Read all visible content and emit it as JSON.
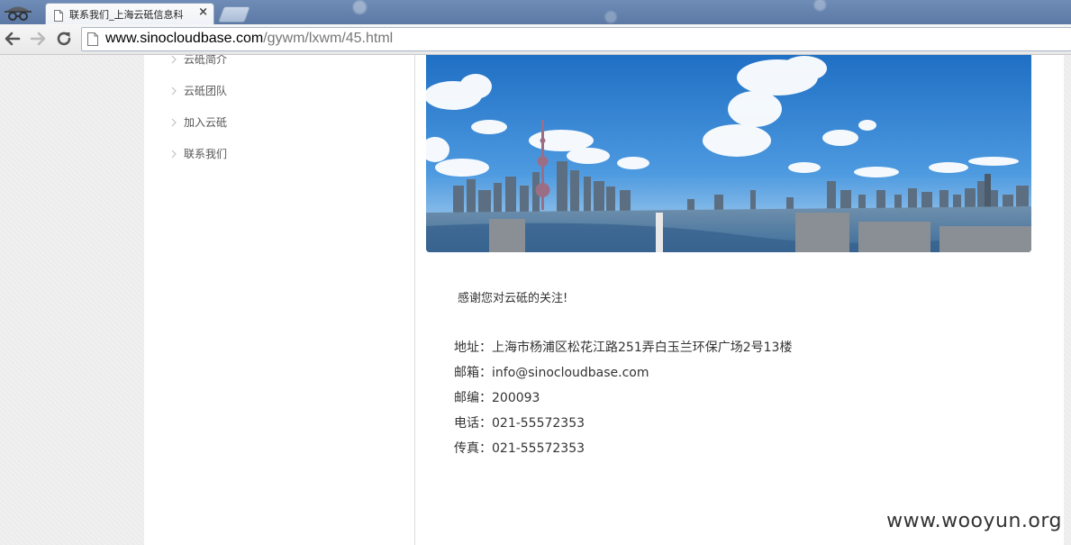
{
  "browser": {
    "tab_title": "联系我们_上海云砥信息科",
    "tab_close": "×",
    "url_host": "www.sinocloudbase.com",
    "url_path": "/gywm/lxwm/45.html"
  },
  "sidebar": {
    "items": [
      {
        "label": "云砥简介"
      },
      {
        "label": "云砥团队"
      },
      {
        "label": "加入云砥"
      },
      {
        "label": "联系我们"
      }
    ]
  },
  "content": {
    "greeting": "感谢您对云砥的关注!",
    "address": "地址：上海市杨浦区松花江路251弄白玉兰环保广场2号13楼",
    "email": "邮箱：info@sinocloudbase.com",
    "postcode": "邮编：200093",
    "phone": "电话：021-55572353",
    "fax": "传真：021-55572353"
  },
  "watermark": "www.wooyun.org",
  "icons": {
    "incognito": "incognito-icon",
    "back": "back-arrow-icon",
    "forward": "forward-arrow-icon",
    "reload": "reload-icon",
    "page": "page-icon",
    "chevron": "chevron-right-icon"
  },
  "colors": {
    "sky": "#2f86d6",
    "water": "#3d6d9a"
  }
}
